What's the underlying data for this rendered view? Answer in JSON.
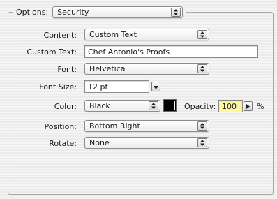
{
  "options": {
    "label": "Options:",
    "value": "Security"
  },
  "fields": {
    "content": {
      "label": "Content:",
      "value": "Custom Text"
    },
    "custom_text": {
      "label": "Custom Text:",
      "value": "Chef Antonio's Proofs"
    },
    "font": {
      "label": "Font:",
      "value": "Helvetica"
    },
    "font_size": {
      "label": "Font Size:",
      "value": "12 pt"
    },
    "color": {
      "label": "Color:",
      "value": "Black",
      "swatch": "#000000"
    },
    "opacity": {
      "label": "Opacity:",
      "value": "100",
      "unit": "%"
    },
    "position": {
      "label": "Position:",
      "value": "Bottom Right"
    },
    "rotate": {
      "label": "Rotate:",
      "value": "None"
    }
  },
  "icons": {
    "popup_arrows": "updown-arrows-icon",
    "combo_arrow": "chevron-down-icon",
    "stepper": "chevron-right-icon"
  },
  "colors": {
    "opacity_highlight": "#fff6a0"
  }
}
